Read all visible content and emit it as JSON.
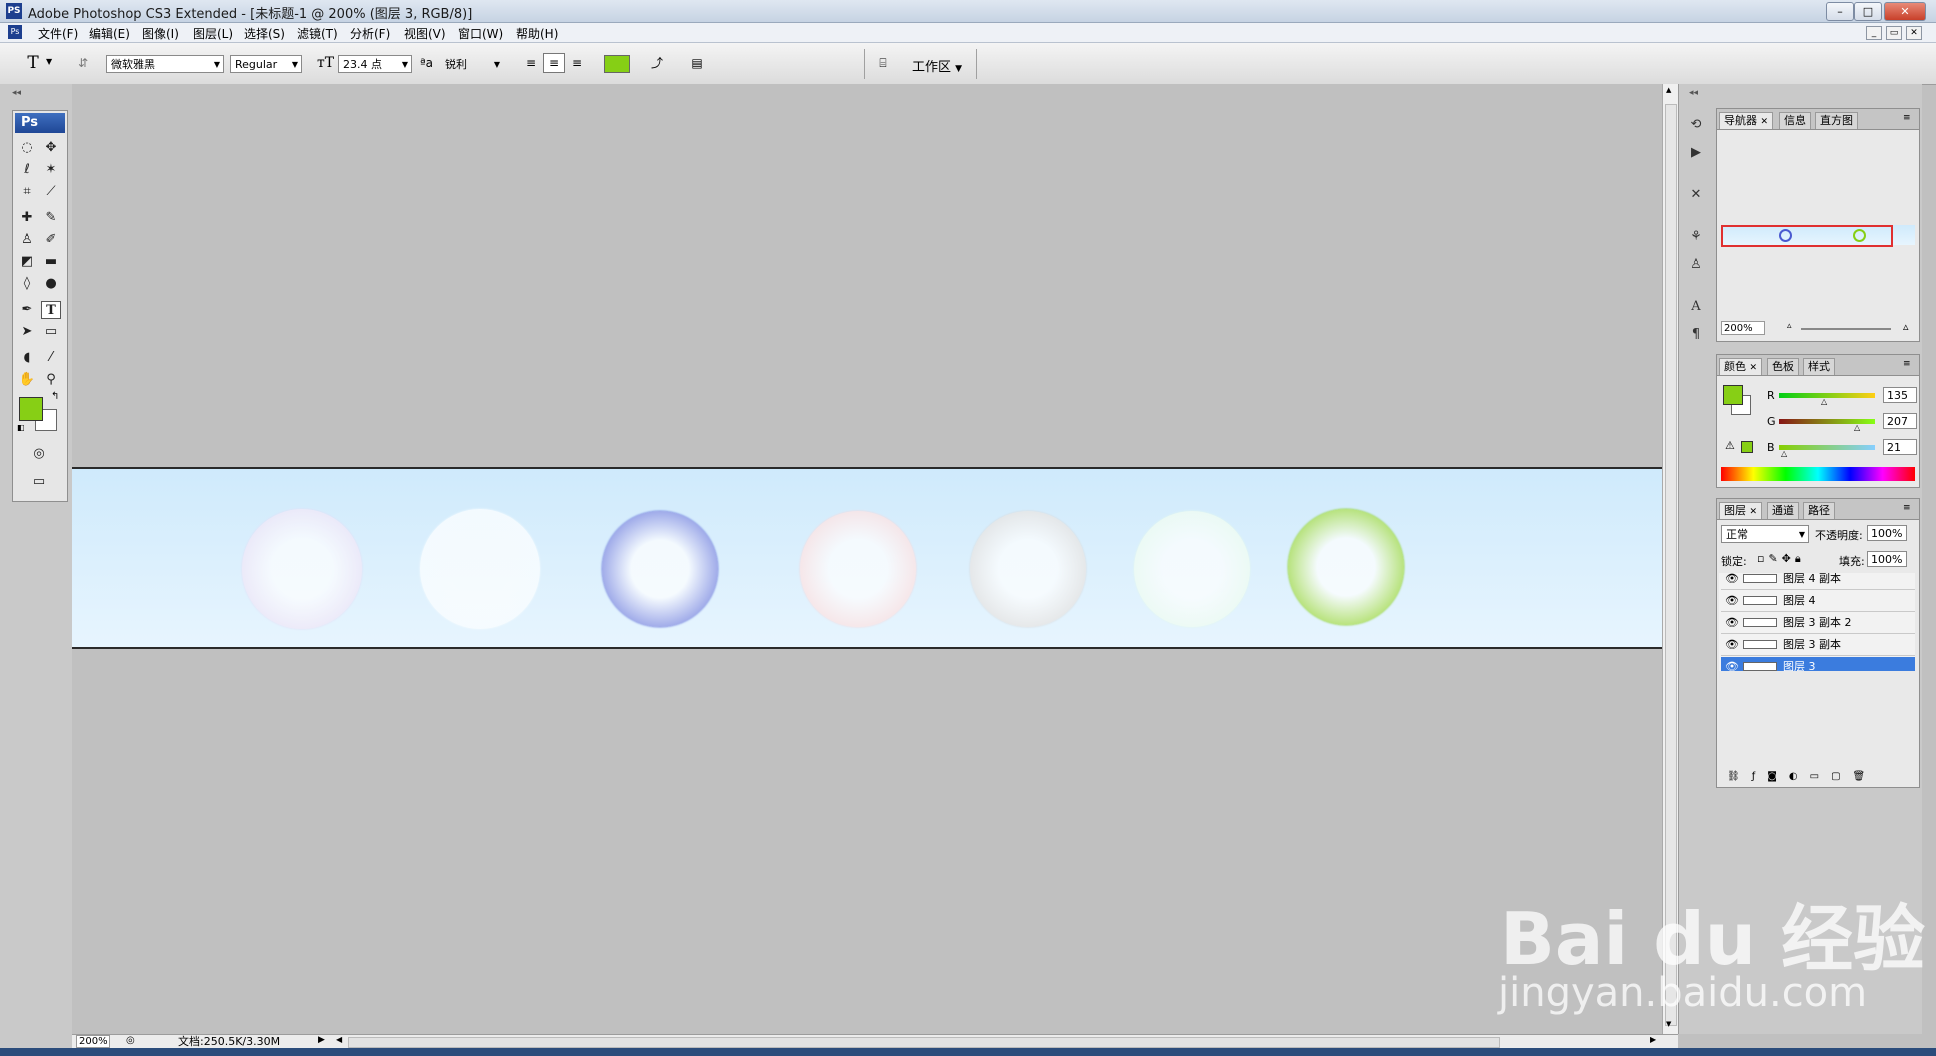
{
  "titlebar": {
    "app_icon": "PS",
    "title": "Adobe Photoshop CS3 Extended - [未标题-1 @ 200% (图层 3, RGB/8)]",
    "minimize": "–",
    "maximize": "□",
    "close": "✕"
  },
  "menu": [
    "文件(F)",
    "编辑(E)",
    "图像(I)",
    "图层(L)",
    "选择(S)",
    "滤镜(T)",
    "分析(F)",
    "视图(V)",
    "窗口(W)",
    "帮助(H)"
  ],
  "options": {
    "tool_icon": "T",
    "font_family": "微软雅黑",
    "font_style": "Regular",
    "font_size": "23.4 点",
    "antialias_label": "ªa",
    "antialias": "锐利",
    "text_color": "#86cf15",
    "workspace_label": "工作区"
  },
  "tools_panel": {
    "logo": "Ps"
  },
  "colors": {
    "foreground": "#87cf15",
    "background": "#ffffff",
    "doc_bg_top": "#cfeafc",
    "doc_bg_bottom": "#e7f5fe",
    "selected_layer": "#3b7cde"
  },
  "bubbles": [
    {
      "color": "#e4dcf4"
    },
    {
      "color": "#f4fbff"
    },
    {
      "color": "#5a6ad8"
    },
    {
      "color": "#f6d6d8"
    },
    {
      "color": "#d8d8d8"
    },
    {
      "color": "#e4f9ec"
    },
    {
      "color": "#86cf15"
    }
  ],
  "navigator": {
    "tabs": [
      "导航器",
      "信息",
      "直方图"
    ],
    "zoom": "200%"
  },
  "color_panel": {
    "tabs": [
      "颜色",
      "色板",
      "样式"
    ],
    "r_label": "R",
    "r_value": "135",
    "g_label": "G",
    "g_value": "207",
    "b_label": "B",
    "b_value": "21"
  },
  "layers_panel": {
    "tabs": [
      "图层",
      "通道",
      "路径"
    ],
    "blend_mode": "正常",
    "opacity_label": "不透明度:",
    "opacity": "100%",
    "lock_label": "锁定:",
    "fill_label": "填充:",
    "fill": "100%",
    "layers": [
      {
        "name": "图层 4 副本",
        "selected": false
      },
      {
        "name": "图层 4",
        "selected": false
      },
      {
        "name": "图层 3 副本 2",
        "selected": false
      },
      {
        "name": "图层 3 副本",
        "selected": false
      },
      {
        "name": "图层 3",
        "selected": true
      }
    ]
  },
  "status": {
    "zoom": "200%",
    "doc_info": "文档:250.5K/3.30M"
  },
  "watermark": {
    "brand": "Bai du 经验",
    "url": "jingyan.baidu.com"
  }
}
